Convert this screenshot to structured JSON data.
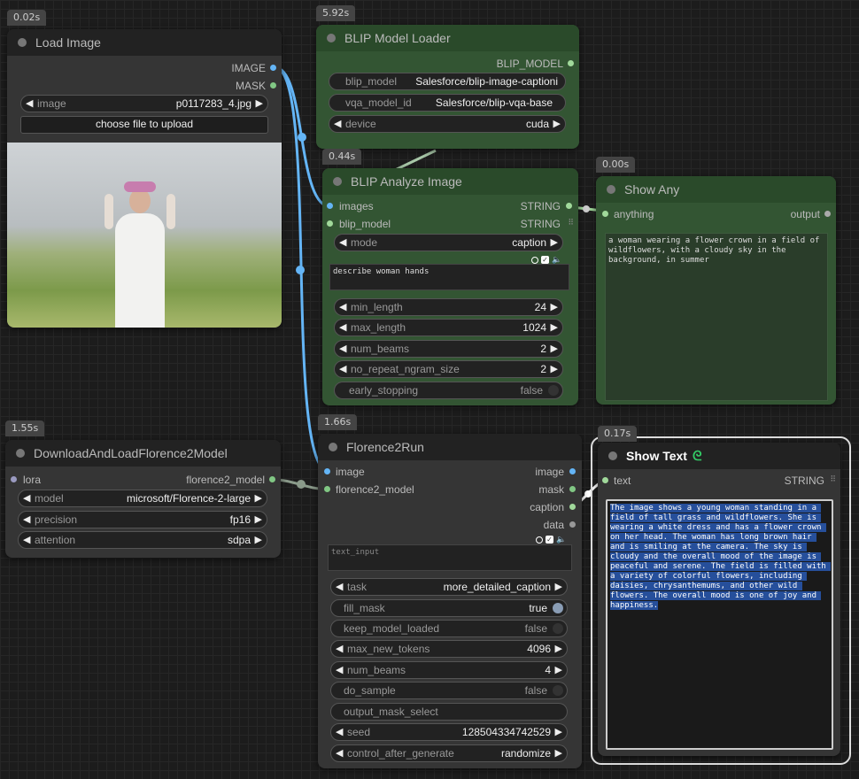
{
  "colors": {
    "image": "#64b5f6",
    "mask": "#81c784",
    "string": "#a1d99b",
    "model": "#b0b0b0"
  },
  "load_image": {
    "time": "0.02s",
    "title": "Load Image",
    "outputs": [
      "IMAGE",
      "MASK"
    ],
    "image_label": "image",
    "image_value": "p0117283_4.jpg",
    "upload_label": "choose file to upload"
  },
  "blip_loader": {
    "time": "5.92s",
    "title": "BLIP Model Loader",
    "output": "BLIP_MODEL",
    "widgets": [
      {
        "label": "blip_model",
        "value": "Salesforce/blip-image-captioni"
      },
      {
        "label": "vqa_model_id",
        "value": "Salesforce/blip-vqa-base"
      },
      {
        "label": "device",
        "value": "cuda"
      }
    ]
  },
  "blip_analyze": {
    "time": "0.44s",
    "title": "BLIP Analyze Image",
    "inputs": [
      "images",
      "blip_model"
    ],
    "outputs": [
      "STRING",
      "STRING"
    ],
    "mode_label": "mode",
    "mode_value": "caption",
    "question": "describe woman hands",
    "widgets": [
      {
        "label": "min_length",
        "value": "24"
      },
      {
        "label": "max_length",
        "value": "1024"
      },
      {
        "label": "num_beams",
        "value": "2"
      },
      {
        "label": "no_repeat_ngram_size",
        "value": "2"
      }
    ],
    "early_label": "early_stopping",
    "early_value": "false"
  },
  "show_any": {
    "time": "0.00s",
    "title": "Show Any",
    "input": "anything",
    "output": "output",
    "text": "a woman wearing a flower crown in a field of wildflowers, with a cloudy sky in the background, in summer"
  },
  "download_florence": {
    "time": "1.55s",
    "title": "DownloadAndLoadFlorence2Model",
    "input": "lora",
    "output": "florence2_model",
    "widgets": [
      {
        "label": "model",
        "value": "microsoft/Florence-2-large"
      },
      {
        "label": "precision",
        "value": "fp16"
      },
      {
        "label": "attention",
        "value": "sdpa"
      }
    ]
  },
  "florence_run": {
    "time": "1.66s",
    "title": "Florence2Run",
    "inputs": [
      "image",
      "florence2_model"
    ],
    "outputs": [
      "image",
      "mask",
      "caption",
      "data"
    ],
    "text_input_placeholder": "text_input",
    "widgets": [
      {
        "label": "task",
        "value": "more_detailed_caption",
        "type": "combo"
      },
      {
        "label": "fill_mask",
        "value": "true",
        "type": "toggle"
      },
      {
        "label": "keep_model_loaded",
        "value": "false",
        "type": "toggle"
      },
      {
        "label": "max_new_tokens",
        "value": "4096",
        "type": "combo"
      },
      {
        "label": "num_beams",
        "value": "4",
        "type": "combo"
      },
      {
        "label": "do_sample",
        "value": "false",
        "type": "toggle"
      },
      {
        "label": "output_mask_select",
        "value": "",
        "type": "text"
      },
      {
        "label": "seed",
        "value": "128504334742529",
        "type": "combo"
      },
      {
        "label": "control_after_generate",
        "value": "randomize",
        "type": "combo"
      }
    ]
  },
  "show_text": {
    "time": "0.17s",
    "title": "Show Text",
    "input": "text",
    "output": "STRING",
    "text": "The image shows a young woman standing in a field of tall grass and wildflowers. She is wearing a white dress and has a flower crown on her head. The woman has long brown hair and is smiling at the camera. The sky is cloudy and the overall mood of the image is peaceful and serene. The field is filled with a variety of colorful flowers, including daisies, chrysanthemums, and other wild flowers. The overall mood is one of joy and happiness."
  }
}
